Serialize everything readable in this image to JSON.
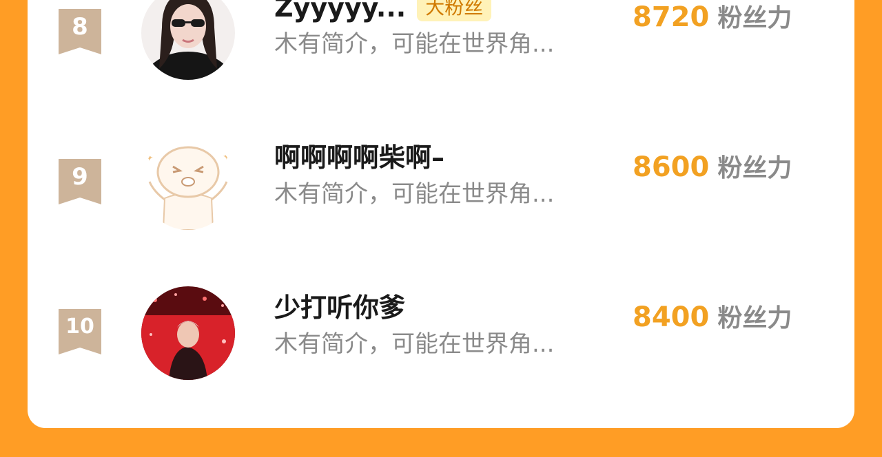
{
  "rows": [
    {
      "rank": "8",
      "name": "Zyyyyy...",
      "tag": "大粉丝",
      "bio": "木有简介，可能在世界角...",
      "score": "8720",
      "unit": "粉丝力"
    },
    {
      "rank": "9",
      "name": "啊啊啊啊柴啊–",
      "bio": "木有简介，可能在世界角...",
      "score": "8600",
      "unit": "粉丝力"
    },
    {
      "rank": "10",
      "name": "少打听你爹",
      "bio": "木有简介，可能在世界角...",
      "score": "8400",
      "unit": "粉丝力"
    }
  ],
  "colors": {
    "background": "#ff9d25",
    "card": "#ffffff",
    "score": "#f2a122",
    "badge": "#cdb49a",
    "tag_bg": "#fff2b8"
  }
}
